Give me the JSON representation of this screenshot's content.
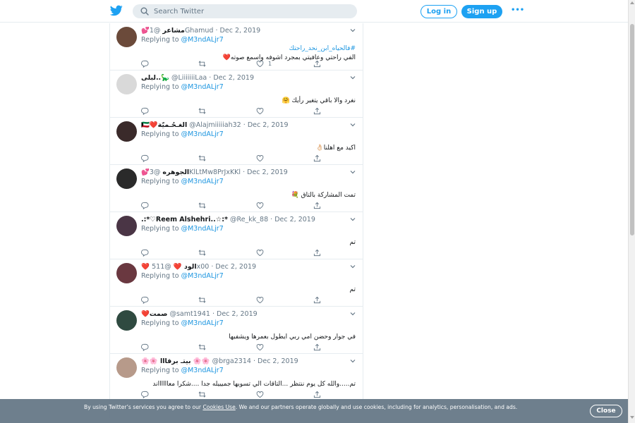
{
  "header": {
    "search_placeholder": "Search Twitter",
    "login_label": "Log in",
    "signup_label": "Sign up",
    "more_label": "•••"
  },
  "tweets": [
    {
      "name": "مشاعر",
      "name_emoji": "💕",
      "handle": "@1Ghamud",
      "sep": "·",
      "date": "Dec 2, 2019",
      "replying_prefix": "Replying to ",
      "replying_handle": "@M3ndALjr7",
      "hashtag": "#فالحياه_ابن_نحد_راحتك",
      "text": "الفي راحتي وعافيتي بمجرد اشوفه واسمع صوته❤️",
      "like_count": "1",
      "avatar_color": "#6b4a3a"
    },
    {
      "name": "لبلى..🦕",
      "name_emoji": "",
      "handle": "@LiiiiiiiLaa",
      "sep": "·",
      "date": "Dec 2, 2019",
      "replying_prefix": "Replying to ",
      "replying_handle": "@M3ndALjr7",
      "text": "نغرد والا باقي يتغير رأيك 🤗",
      "like_count": "",
      "avatar_color": "#d9d9d9"
    },
    {
      "name": "الغـحُـميّة",
      "name_emoji": "🇰🇼❤️",
      "handle": "@Alajmiiiiiah32",
      "sep": "·",
      "date": "Dec 2, 2019",
      "replying_prefix": "Replying to ",
      "replying_handle": "@M3ndALjr7",
      "text": "اكيد مع اهلنا👌🏻",
      "like_count": "",
      "avatar_color": "#3a2a2a"
    },
    {
      "name": "الجوهره",
      "name_emoji": "💕",
      "handle": "@3KlLtMw8PrJxKKl",
      "sep": "·",
      "date": "Dec 2, 2019",
      "replying_prefix": "Replying to ",
      "replying_handle": "@M3ndALjr7",
      "text": "تمت المشاركة بالتاق 💐",
      "like_count": "",
      "avatar_color": "#2a2a2a"
    },
    {
      "name": ".:*♡Reem Alshehri..☆:*",
      "name_emoji": "",
      "handle": "@Re_kk_88",
      "sep": "·",
      "date": "Dec 2, 2019",
      "replying_prefix": "Replying to ",
      "replying_handle": "@M3ndALjr7",
      "text": "تم",
      "like_count": "",
      "avatar_color": "#4a3545"
    },
    {
      "name": "❤️ الود ❤️",
      "name_emoji": "",
      "handle": "@511x00",
      "sep": "·",
      "date": "Dec 2, 2019",
      "replying_prefix": "Replying to ",
      "replying_handle": "@M3ndALjr7",
      "text": "تم",
      "like_count": "",
      "avatar_color": "#6a3840"
    },
    {
      "name": "صمت",
      "name_emoji": "❤️",
      "handle": "@samt1941",
      "sep": "·",
      "date": "Dec 2, 2019",
      "replying_prefix": "Replying to ",
      "replying_handle": "@M3ndALjr7",
      "text": "في جوار وحضن امي ربي ايطول بعمرها ويشفيها",
      "like_count": "",
      "avatar_color": "#2f4a40"
    },
    {
      "name": "🌸🌸 بيتـ برقااا 🌸🌸",
      "name_emoji": "",
      "handle": "@brga2314",
      "sep": "·",
      "date": "Dec 2, 2019",
      "replying_prefix": "Replying to ",
      "replying_handle": "@M3ndALjr7",
      "text": "تم.....والله كل يوم ننتظر ...التاقات الي تسويها جميييله جدا ....شكرا معااااااند",
      "like_count": "",
      "avatar_color": "#b79a8a"
    }
  ],
  "cookie": {
    "text_before": "By using Twitter’s services you agree to our ",
    "link": "Cookies Use",
    "text_after": ". We and our partners operate globally and use cookies, including for analytics, personalisation, and ads.",
    "close_label": "Close"
  },
  "colors": {
    "brand": "#1da1f2",
    "mention": "#1b95e0",
    "secondary_text": "#657786",
    "border": "#e6ecf0"
  },
  "icons": {
    "logo": "twitter-bird-icon",
    "search": "search-icon",
    "reply": "reply-icon",
    "retweet": "retweet-icon",
    "like": "heart-icon",
    "share": "share-icon",
    "caret": "chevron-down-icon"
  }
}
